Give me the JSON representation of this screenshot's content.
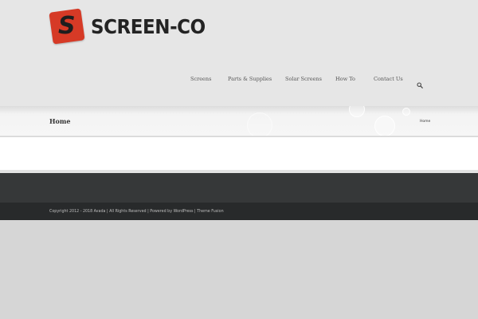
{
  "brand": {
    "logo_mark": "S",
    "name": "SCREEN-CO",
    "accent": "#d63a26"
  },
  "nav": {
    "items": [
      {
        "label": "Screens"
      },
      {
        "label": "Parts & Supplies"
      },
      {
        "label": "Solar Screens"
      },
      {
        "label": "How To"
      },
      {
        "label": "Contact Us"
      }
    ],
    "search_icon": "search-icon"
  },
  "title_bar": {
    "title": "Home",
    "breadcrumb": "Home"
  },
  "footer": {
    "copyright": {
      "prefix": "Copyright 2012 - 2018 Avada | All Rights Reserved | Powered by ",
      "link1": "WordPress",
      "separator": " | ",
      "link2": "Theme Fusion"
    }
  },
  "colors": {
    "header_bg": "#e6e6e6",
    "footer_bg": "#363839",
    "copyright_bg": "#282a2b",
    "page_bg": "#d6d6d6"
  }
}
